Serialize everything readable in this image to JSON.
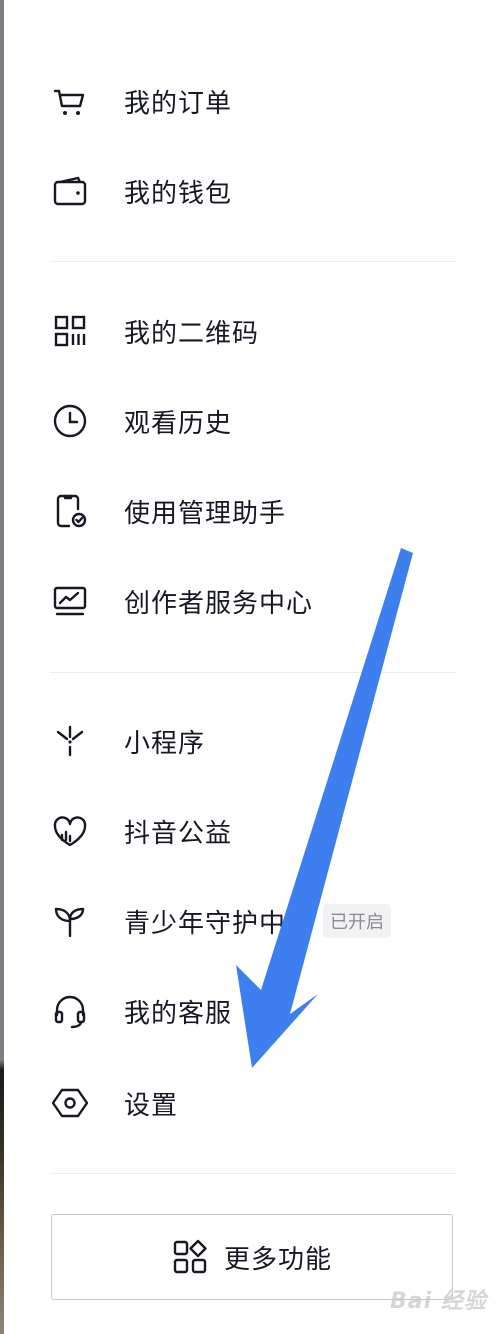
{
  "menu": {
    "orders": "我的订单",
    "wallet": "我的钱包",
    "qrcode": "我的二维码",
    "history": "观看历史",
    "usage_assistant": "使用管理助手",
    "creator_center": "创作者服务中心",
    "mini_programs": "小程序",
    "charity": "抖音公益",
    "youth_mode": "青少年守护中心",
    "youth_mode_status": "已开启",
    "customer_service": "我的客服",
    "settings": "设置"
  },
  "more_button": {
    "label": "更多功能"
  },
  "watermark": "Bai 经验",
  "colors": {
    "annotation_arrow": "#3e7ff0",
    "text": "#161823",
    "badge_bg": "#f2f2f4"
  }
}
